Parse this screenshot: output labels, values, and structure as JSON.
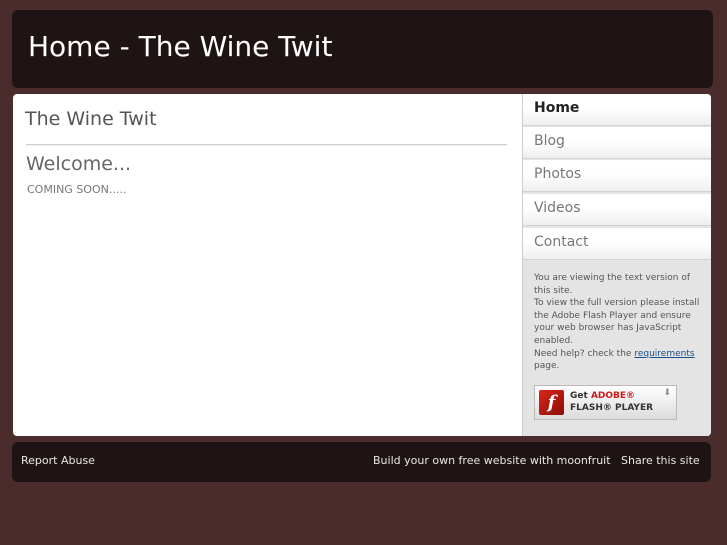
{
  "header": {
    "title": "Home - The Wine Twit"
  },
  "main": {
    "site_title": "The Wine Twit",
    "heading": "Welcome...",
    "body": "COMING SOON....."
  },
  "nav": {
    "items": [
      {
        "label": "Home",
        "active": true
      },
      {
        "label": "Blog"
      },
      {
        "label": "Photos"
      },
      {
        "label": "Videos"
      },
      {
        "label": "Contact"
      }
    ]
  },
  "notice": {
    "line1": "You are viewing the text version of this site.",
    "line2": "To view the full version please install the Adobe Flash Player and ensure your web browser has JavaScript enabled.",
    "help_prefix": "Need help? check the ",
    "help_link": "requirements",
    "help_suffix": "page."
  },
  "flash_badge": {
    "logo_glyph": "f",
    "get": "Get ",
    "adobe": "ADOBE®",
    "product": "FLASH® PLAYER",
    "arrow": "⬇"
  },
  "footer": {
    "report_abuse": "Report Abuse",
    "build": "Build your own free website with moonfruit",
    "share": "Share this site"
  },
  "colors": {
    "page_bg": "#4a2c2c",
    "header_bg": "#1e1414",
    "flash_red": "#cc1a1a"
  }
}
